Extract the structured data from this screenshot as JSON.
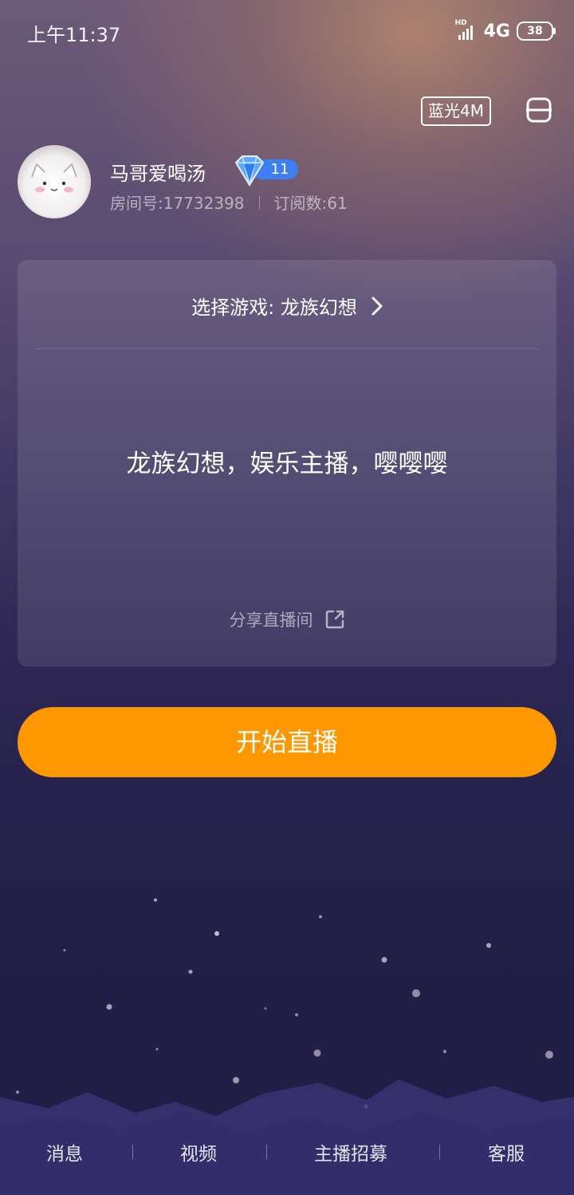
{
  "status_bar": {
    "time": "上午11:37",
    "network": "4G",
    "signal_label": "HD",
    "battery": "38"
  },
  "header": {
    "quality": "蓝光4M",
    "menu_icon": "menu-icon"
  },
  "profile": {
    "username": "马哥爱喝汤",
    "level": "11",
    "room_id": "房间号:17732398",
    "subscribers": "订阅数:61"
  },
  "card": {
    "game_select": "选择游戏: 龙族幻想",
    "stream_title": "龙族幻想，娱乐主播，嘤嘤嘤",
    "share": "分享直播间"
  },
  "actions": {
    "start_live": "开始直播"
  },
  "bottom_nav": {
    "items": [
      "消息",
      "视频",
      "主播招募",
      "客服"
    ]
  },
  "colors": {
    "accent": "#ff9800",
    "level_badge": "#3d7ef2"
  }
}
